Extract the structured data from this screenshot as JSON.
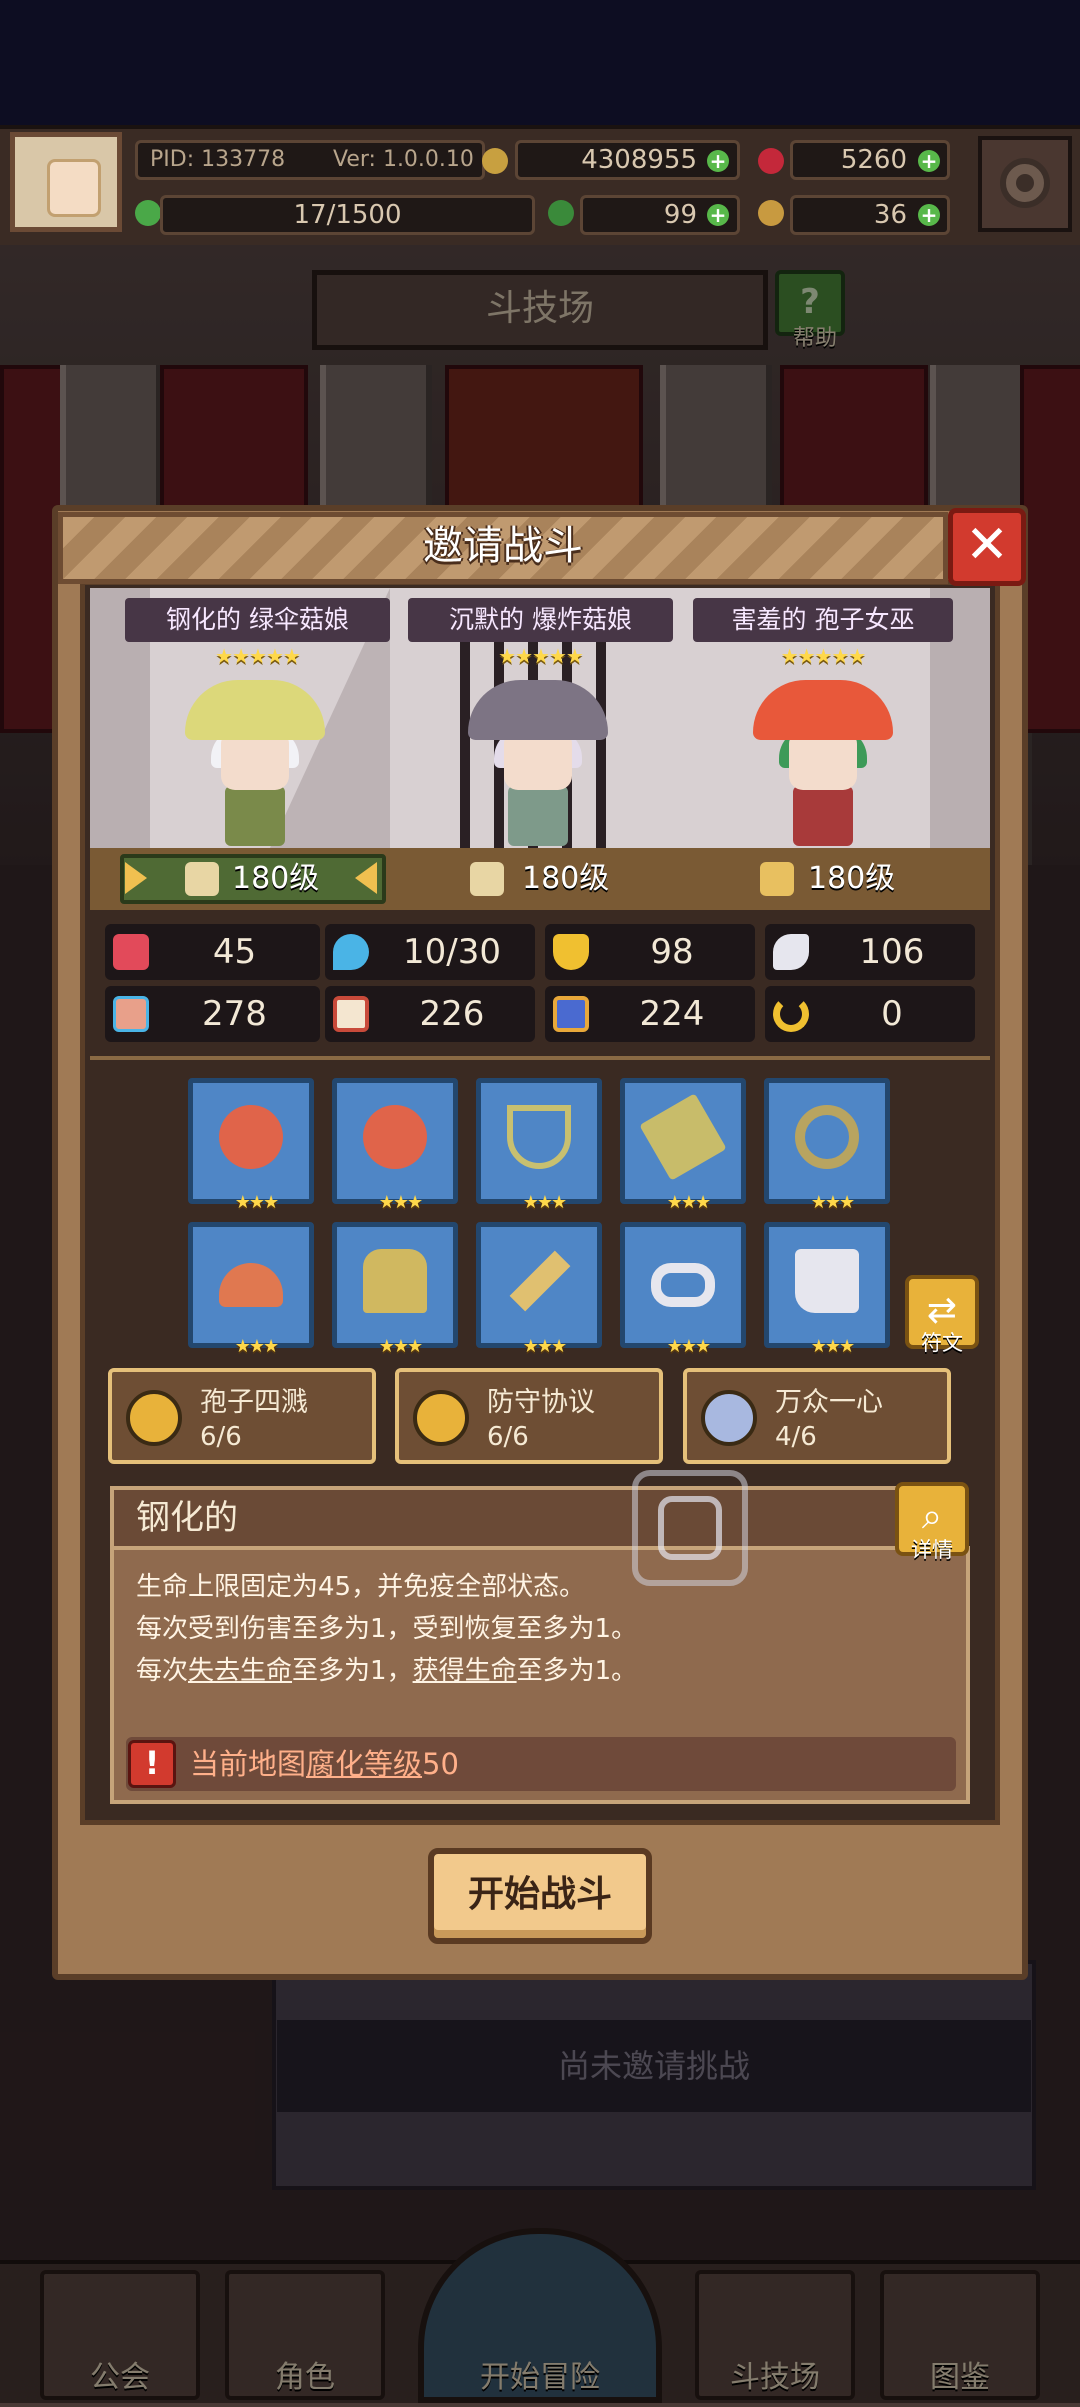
{
  "status": {
    "pid": "PID: 133778",
    "version": "Ver: 1.0.0.10",
    "gold": "4308955",
    "gems": "5260",
    "stamina": "17/1500",
    "clover": "99",
    "keys": "36"
  },
  "arena": {
    "title": "斗技场",
    "help_label": "帮助",
    "help_glyph": "?",
    "challenge_status": "尚未邀请挑战"
  },
  "modal": {
    "title": "邀请战斗",
    "close_glyph": "✕",
    "party": [
      {
        "name": "钢化的 绿伞菇娘",
        "stars": "★★★★★",
        "hat_color": "#dcd87a",
        "hair_color": "#f2f2f6",
        "body_color": "#7a8a4a"
      },
      {
        "name": "沉默的 爆炸菇娘",
        "stars": "★★★★★",
        "hat_color": "#7d7484",
        "hair_color": "#e4dcea",
        "body_color": "#7e9a8a"
      },
      {
        "name": "害羞的 孢子女巫",
        "stars": "★★★★★",
        "hat_color": "#e8583a",
        "hair_color": "#3d9a58",
        "body_color": "#a83a3a"
      }
    ],
    "levels": [
      {
        "label": "180级",
        "icon": "target-icon"
      },
      {
        "label": "180级",
        "icon": "scroll-icon"
      },
      {
        "label": "180级",
        "icon": "key-icon"
      }
    ],
    "stats": [
      {
        "icon": "heart-icon",
        "value": "45",
        "color": "#e24a5a"
      },
      {
        "icon": "mana-drop-icon",
        "value": "10/30",
        "color": "#4ab4e6"
      },
      {
        "icon": "shield-icon",
        "value": "98",
        "color": "#f0c030"
      },
      {
        "icon": "wing-icon",
        "value": "106",
        "color": "#e6e6ee"
      },
      {
        "icon": "fist-icon",
        "value": "278",
        "color": "#e8a08a"
      },
      {
        "icon": "book-icon",
        "value": "226",
        "color": "#c84a3a"
      },
      {
        "icon": "potion-icon",
        "value": "224",
        "color": "#e8a83a"
      },
      {
        "icon": "horseshoe-icon",
        "value": "0",
        "color": "#f0c030"
      }
    ],
    "equipment": [
      {
        "name": "spotted-orb-icon",
        "stars": "★★★",
        "color": "#e0644a"
      },
      {
        "name": "spotted-orb-icon",
        "stars": "★★★",
        "color": "#e0644a"
      },
      {
        "name": "amulet-icon",
        "stars": "★★★",
        "color": "#c8c070"
      },
      {
        "name": "gold-card-icon",
        "stars": "★★★",
        "color": "#c8bc6a"
      },
      {
        "name": "ring-icon",
        "stars": "★★★",
        "color": "#b8a460"
      },
      {
        "name": "mushroom-cap-icon",
        "stars": "★★★",
        "color": "#e07850"
      },
      {
        "name": "armor-icon",
        "stars": "★★★",
        "color": "#d0b860"
      },
      {
        "name": "dagger-icon",
        "stars": "★★★",
        "color": "#e0c070"
      },
      {
        "name": "belt-icon",
        "stars": "★★★",
        "color": "#e6e6ee"
      },
      {
        "name": "boots-icon",
        "stars": "★★★",
        "color": "#e6e6ee"
      }
    ],
    "rune_label": "符文",
    "rune_glyph": "⇄",
    "sets": [
      {
        "name": "孢子四溅",
        "count": "6/6",
        "color": "#e8b23a"
      },
      {
        "name": "防守协议",
        "count": "6/6",
        "color": "#e8b23a"
      },
      {
        "name": "万众一心",
        "count": "4/6",
        "color": "#a8b8e0"
      }
    ],
    "trait": {
      "title": "钢化的",
      "line1": "生命上限固定为45，并免疫全部状态。",
      "line2": "每次受到伤害至多为1，受到恢复至多为1。",
      "line3_a": "每次",
      "line3_b": "失去生命",
      "line3_c": "至多为1，",
      "line3_d": "获得生命",
      "line3_e": "至多为1。",
      "warn_a": "当前地图",
      "warn_b": "腐化等级",
      "warn_c": "50",
      "warn_glyph": "!"
    },
    "detail_label": "详情",
    "detail_glyph": "⌕",
    "start_button": "开始战斗"
  },
  "nav": [
    {
      "label": "公会"
    },
    {
      "label": "角色"
    },
    {
      "label": "开始冒险"
    },
    {
      "label": "斗技场"
    },
    {
      "label": "图鉴"
    }
  ]
}
